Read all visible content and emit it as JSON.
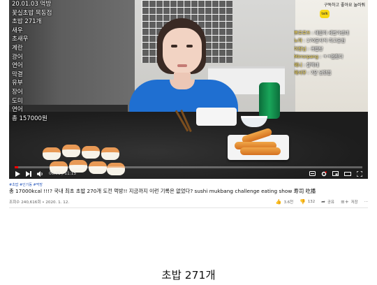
{
  "video": {
    "overlay_left_lines": [
      "20.01.03 먹방",
      "꽃실초밥 목동점",
      "초밥 271개",
      "새우",
      "초새우",
      "계란",
      "광어",
      "연어",
      "막결",
      "유부",
      "장어",
      "도미",
      "연어",
      "총 157000원"
    ],
    "chat_lines": [
      {
        "nick": "뽀로로쓰",
        "text": "제한이 세번가셨네"
      },
      {
        "nick": "노아",
        "text": "170분사식 최고운원"
      },
      {
        "nick": "이장님",
        "text": "귀엽당"
      },
      {
        "nick": "Mirrorpang",
        "text": "ㅋㅋ멈췄다"
      },
      {
        "nick": "제니",
        "text": "잘먹네"
      },
      {
        "nick": "재서무",
        "text": "7분 남았음"
      }
    ],
    "top_right_note": "구독하고 좋아요 눌러줘",
    "kakao_badge": "talk",
    "time": "00:01 / 11:15",
    "progress_fraction": 0.01
  },
  "info": {
    "hashtags": "#초밥 #인기동 #먹방",
    "title": "총 17000kcal !!!? 국내 최초 초밥 270개 도전 먹방!! 지금까지 이런 기록은 없었다? sushi mukbang challenge eating show 寿司 吃播",
    "views": "조회수 240,616회 • 2020. 1. 12.",
    "likes": "3.6천",
    "dislikes": "132",
    "share": "공유",
    "save": "저장",
    "more": "⋯"
  },
  "caption": "초밥 271개",
  "icons": {
    "play": "play-icon",
    "next": "next-icon",
    "volume": "volume-icon",
    "settings": "gear-icon"
  }
}
